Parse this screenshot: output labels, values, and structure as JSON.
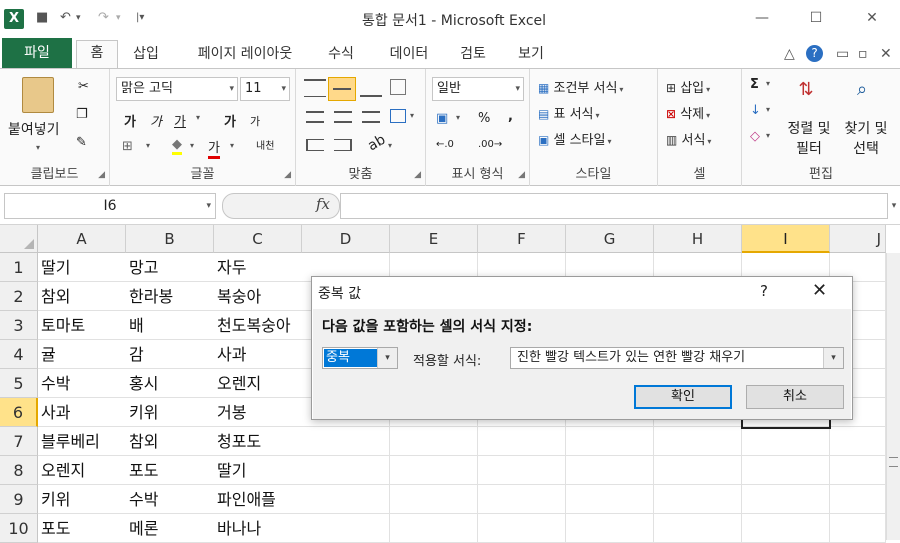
{
  "window": {
    "title": "통합 문서1  -  Microsoft Excel",
    "logo": "X",
    "min": "—",
    "max": "☐",
    "close": "✕"
  },
  "qat": {
    "save": "■",
    "undo": "↶",
    "undo_dd": "▾",
    "redo": "↷",
    "redo_dd": "▾",
    "custom": "|▾"
  },
  "tabs": {
    "file": "파일",
    "home": "홈",
    "insert": "삽입",
    "pagelayout": "페이지 레이아웃",
    "formulas": "수식",
    "data": "데이터",
    "review": "검토",
    "view": "보기"
  },
  "tab_right": {
    "collapse": "△",
    "help": "?",
    "min": "▭",
    "restore": "▫",
    "close": "✕"
  },
  "ribbon": {
    "clipboard": {
      "label": "클립보드",
      "paste": "붙여넣기",
      "cut": "✂",
      "copy": "❐",
      "painter": "✎"
    },
    "font": {
      "label": "글꼴",
      "name": "맑은 고딕",
      "size": "11",
      "bold": "가",
      "italic": "가",
      "underline": "가",
      "grow": "가",
      "shrink": "가",
      "border": "⊞",
      "fill": "◆",
      "fontcolor": "가",
      "phonetic": "내천"
    },
    "align": {
      "label": "맞춤"
    },
    "number": {
      "label": "표시 형식",
      "format": "일반",
      "currency": "▣",
      "percent": "%",
      "comma": ",",
      "inc": "←.0",
      "dec": ".00→"
    },
    "styles": {
      "label": "스타일",
      "cond": "조건부 서식",
      "table": "표 서식",
      "cell": "셀 스타일"
    },
    "cells": {
      "label": "셀",
      "insert": "삽입",
      "delete": "삭제",
      "format": "서식"
    },
    "editing": {
      "label": "편집",
      "sum": "Σ",
      "fill": "↓",
      "clear": "◇",
      "sort": "정렬 및 필터",
      "find": "찾기 및 선택"
    }
  },
  "formula_bar": {
    "name_box": "I6",
    "fx": "fx",
    "value": ""
  },
  "columns": [
    "A",
    "B",
    "C",
    "D",
    "E",
    "F",
    "G",
    "H",
    "I",
    "J"
  ],
  "rows": [
    {
      "n": "1",
      "a": "딸기",
      "b": "망고",
      "c": "자두"
    },
    {
      "n": "2",
      "a": "참외",
      "b": "한라봉",
      "c": "복숭아"
    },
    {
      "n": "3",
      "a": "토마토",
      "b": "배",
      "c": "천도복숭아"
    },
    {
      "n": "4",
      "a": "귤",
      "b": "감",
      "c": "사과"
    },
    {
      "n": "5",
      "a": "수박",
      "b": "홍시",
      "c": "오렌지"
    },
    {
      "n": "6",
      "a": "사과",
      "b": "키위",
      "c": "거봉"
    },
    {
      "n": "7",
      "a": "블루베리",
      "b": "참외",
      "c": "청포도"
    },
    {
      "n": "8",
      "a": "오렌지",
      "b": "포도",
      "c": "딸기"
    },
    {
      "n": "9",
      "a": "키위",
      "b": "수박",
      "c": "파인애플"
    },
    {
      "n": "10",
      "a": "포도",
      "b": "메론",
      "c": "바나나"
    }
  ],
  "dialog": {
    "title": "중복 값",
    "help": "?",
    "close": "✕",
    "heading": "다음 값을 포함하는 셀의 서식 지정:",
    "dup_value": "중복",
    "format_label": "적용할 서식:",
    "format_value": "진한 빨강 텍스트가 있는 연한 빨강 채우기",
    "ok": "확인",
    "cancel": "취소"
  },
  "colors": {
    "excel_green": "#1e7145",
    "selected_header": "#ffe28a",
    "ok_focus": "#0078d7"
  }
}
